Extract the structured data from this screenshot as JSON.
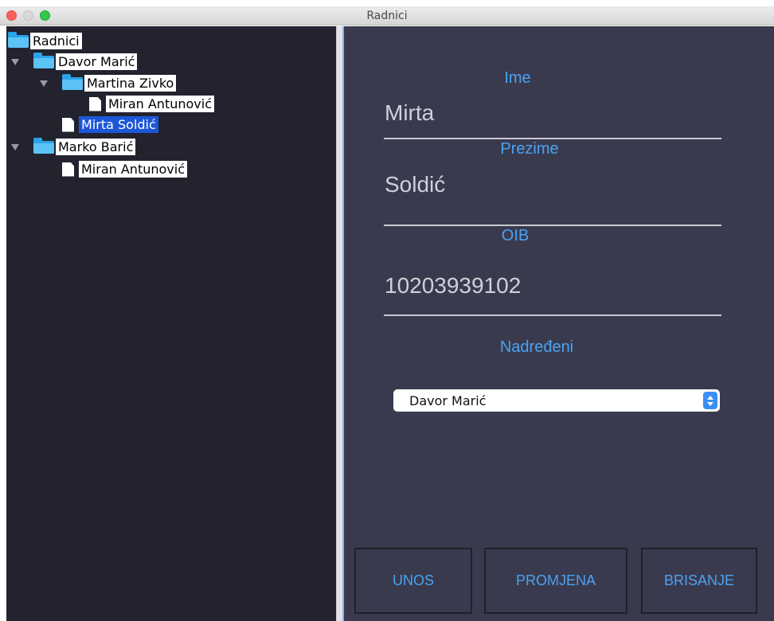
{
  "window": {
    "title": "Radnici"
  },
  "tree": {
    "root": "Radnici",
    "nodes": [
      {
        "label": "Davor Marić",
        "type": "folder",
        "expanded": true
      },
      {
        "label": "Martina Zivko",
        "type": "folder",
        "expanded": true
      },
      {
        "label": "Miran Antunović",
        "type": "file"
      },
      {
        "label": "Mirta Soldić",
        "type": "file",
        "selected": true
      },
      {
        "label": "Marko Barić",
        "type": "folder",
        "expanded": true
      },
      {
        "label": "Miran Antunović",
        "type": "file"
      }
    ]
  },
  "form": {
    "ime_label": "Ime",
    "ime_value": "Mirta",
    "prezime_label": "Prezime",
    "prezime_value": "Soldić",
    "oib_label": "OIB",
    "oib_value": "10203939102",
    "nadredeni_label": "Nadređeni",
    "nadredeni_selected": "Davor Marić"
  },
  "buttons": {
    "unos": "UNOS",
    "promjena": "PROMJENA",
    "brisanje": "BRISANJE"
  },
  "colors": {
    "accent": "#4aa3f0",
    "selection": "#1d57d8",
    "tree_bg": "#22232f",
    "form_bg": "#3a3a4f"
  }
}
